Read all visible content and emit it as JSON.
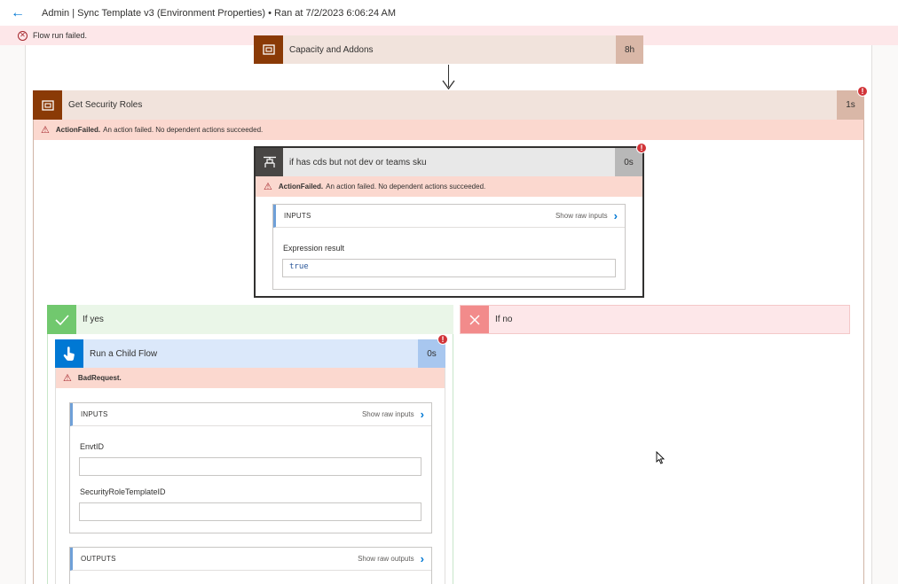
{
  "header": {
    "title": "Admin | Sync Template v3 (Environment Properties) • Ran at 7/2/2023 6:06:24 AM"
  },
  "error_banner": {
    "text": "Flow run failed."
  },
  "capacity_card": {
    "title": "Capacity and Addons",
    "duration": "8h"
  },
  "security_roles": {
    "title": "Get Security Roles",
    "duration": "1s",
    "error_code": "ActionFailed.",
    "error_message": "An action failed. No dependent actions succeeded."
  },
  "condition": {
    "title": "if has cds but not dev or teams sku",
    "duration": "0s",
    "error_code": "ActionFailed.",
    "error_message": "An action failed. No dependent actions succeeded.",
    "inputs_label": "INPUTS",
    "show_raw_inputs": "Show raw inputs",
    "expression_label": "Expression result",
    "expression_value": "true"
  },
  "branches": {
    "yes_label": "If yes",
    "no_label": "If no"
  },
  "child_flow": {
    "title": "Run a Child Flow",
    "duration": "0s",
    "error_code": "BadRequest.",
    "inputs_label": "INPUTS",
    "show_raw_inputs": "Show raw inputs",
    "field1_label": "EnvtID",
    "field1_value": "",
    "field2_label": "SecurityRoleTemplateID",
    "field2_value": "",
    "outputs_label": "OUTPUTS",
    "show_raw_outputs": "Show raw outputs"
  },
  "colors": {
    "accent": "#0078d4",
    "error": "#d13438",
    "error_bg": "#fde7e9",
    "warn_bg": "#fbd8cf",
    "action_brown": "#8a3a06",
    "success_green": "#71c86e",
    "failure_red": "#f28b8b"
  },
  "icons": {
    "back": "back-arrow-icon",
    "error": "error-circle-icon",
    "action": "action-box-icon",
    "condition": "condition-branch-icon",
    "child_flow": "hand-pointer-icon",
    "yes": "check-icon",
    "no": "x-icon"
  }
}
